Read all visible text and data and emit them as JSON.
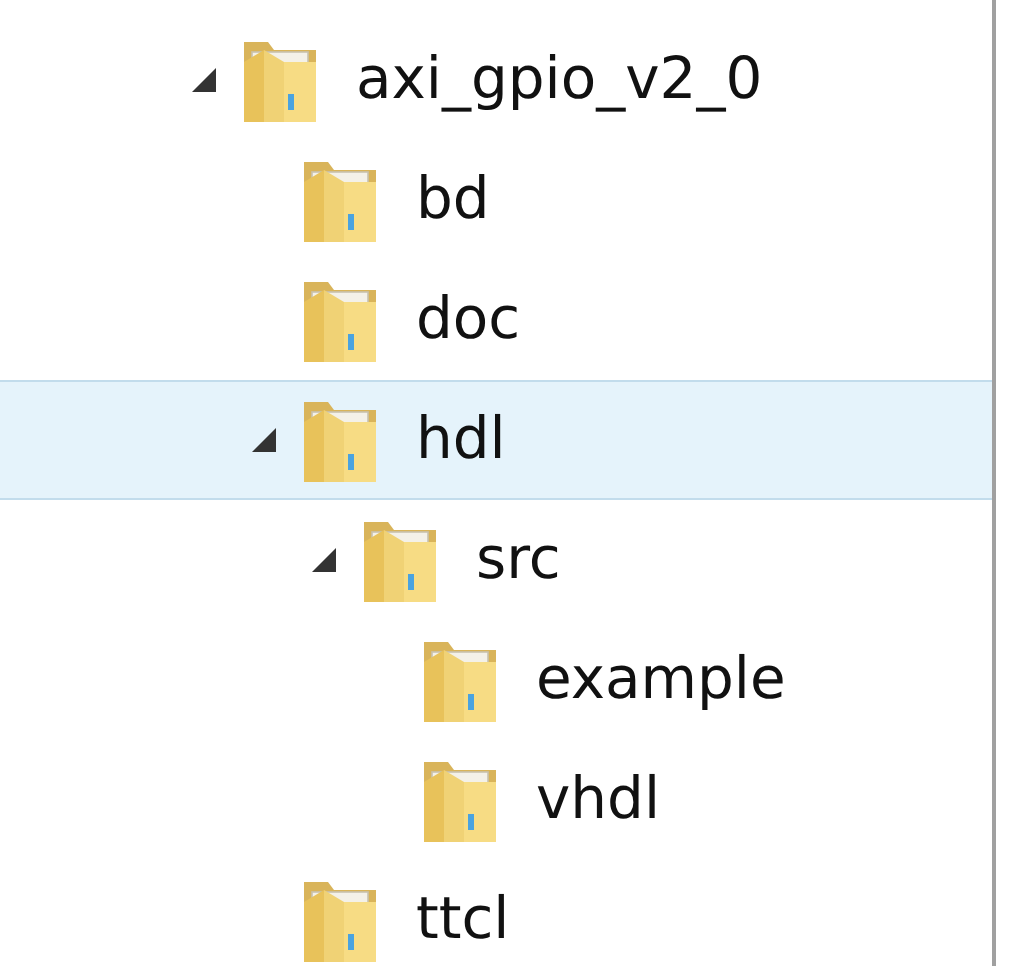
{
  "tree": [
    {
      "label": "axi_gpio_v2_0",
      "expanded": true,
      "selected": false,
      "children": [
        {
          "label": "bd",
          "selected": false
        },
        {
          "label": "doc",
          "selected": false
        },
        {
          "label": "hdl",
          "expanded": true,
          "selected": true,
          "children": [
            {
              "label": "src",
              "expanded": true,
              "selected": false,
              "children": [
                {
                  "label": "example",
                  "selected": false
                },
                {
                  "label": "vhdl",
                  "selected": false
                }
              ]
            }
          ]
        },
        {
          "label": "ttcl",
          "selected": false
        }
      ]
    }
  ]
}
